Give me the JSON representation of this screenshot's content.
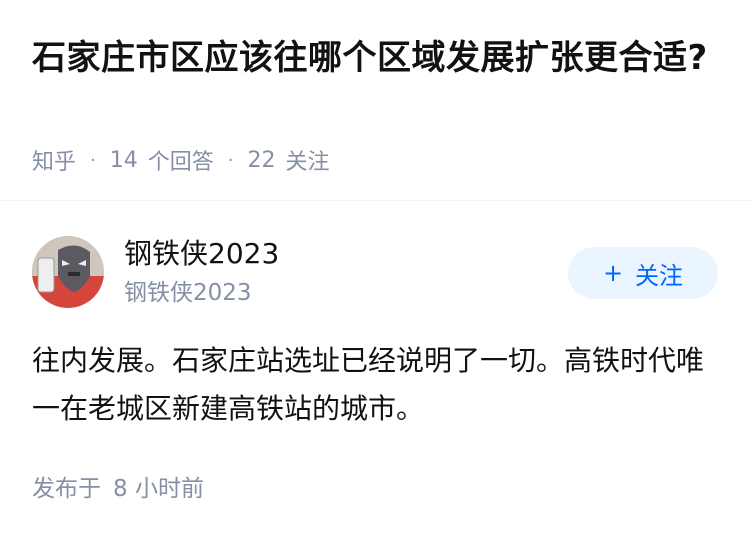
{
  "question": {
    "title": "石家庄市区应该往哪个区域发展扩张更合适?",
    "source": "知乎",
    "answers_count": "14",
    "answers_label": "个回答",
    "followers_count": "22",
    "followers_label": "关注"
  },
  "answer": {
    "author_name": "钢铁侠2023",
    "author_subtitle": "钢铁侠2023",
    "follow_label": "关注",
    "follow_icon": "plus-icon",
    "content": "往内发展。石家庄站选址已经说明了一切。高铁时代唯一在老城区新建高铁站的城市。",
    "published_label": "发布于",
    "published_time": "8 小时前"
  },
  "colors": {
    "title": "#121212",
    "meta": "#8590a6",
    "follow_bg": "#ebf5ff",
    "follow_text": "#0066ff"
  }
}
